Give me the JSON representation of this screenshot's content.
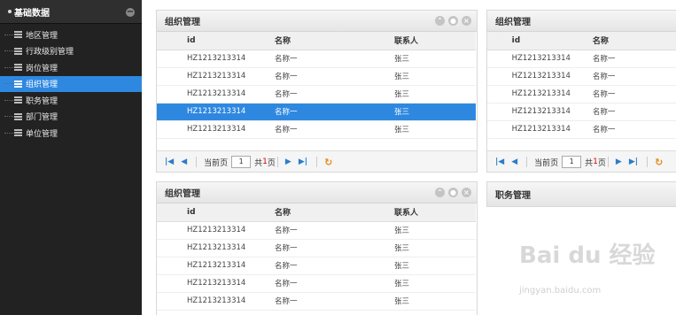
{
  "sidebar": {
    "title": "基础数据",
    "toggle": "−",
    "items": [
      {
        "label": "地区管理",
        "active": false
      },
      {
        "label": "行政级别管理",
        "active": false
      },
      {
        "label": "岗位管理",
        "active": false
      },
      {
        "label": "组织管理",
        "active": true
      },
      {
        "label": "职务管理",
        "active": false
      },
      {
        "label": "部门管理",
        "active": false
      },
      {
        "label": "单位管理",
        "active": false
      }
    ]
  },
  "panels": {
    "top_left": {
      "title": "组织管理",
      "columns": [
        "id",
        "名称",
        "联系人"
      ],
      "rows": [
        [
          "HZ1213213314",
          "名称一",
          "张三"
        ],
        [
          "HZ1213213314",
          "名称一",
          "张三"
        ],
        [
          "HZ1213213314",
          "名称一",
          "张三"
        ],
        [
          "HZ1213213314",
          "名称一",
          "张三"
        ],
        [
          "HZ1213213314",
          "名称一",
          "张三"
        ]
      ],
      "selected_row": 3
    },
    "top_right": {
      "title": "组织管理",
      "columns": [
        "id",
        "名称"
      ],
      "rows": [
        [
          "HZ1213213314",
          "名称一"
        ],
        [
          "HZ1213213314",
          "名称一"
        ],
        [
          "HZ1213213314",
          "名称一"
        ],
        [
          "HZ1213213314",
          "名称一"
        ],
        [
          "HZ1213213314",
          "名称一"
        ]
      ]
    },
    "bottom_left": {
      "title": "组织管理",
      "columns": [
        "id",
        "名称",
        "联系人"
      ],
      "rows": [
        [
          "HZ1213213314",
          "名称一",
          "张三"
        ],
        [
          "HZ1213213314",
          "名称一",
          "张三"
        ],
        [
          "HZ1213213314",
          "名称一",
          "张三"
        ],
        [
          "HZ1213213314",
          "名称一",
          "张三"
        ],
        [
          "HZ1213213314",
          "名称一",
          "张三"
        ]
      ]
    },
    "bottom_right": {
      "title": "职务管理"
    }
  },
  "pager": {
    "current_label": "当前页",
    "page": "1",
    "total_prefix": "共",
    "total_pages": "1",
    "total_suffix": "页"
  },
  "watermark": {
    "text": "Bai du 经验",
    "url": "jingyan.baidu.com"
  },
  "colors": {
    "accent": "#2f88e0",
    "sidebar_bg": "#222222",
    "refresh": "#e88a1a"
  }
}
